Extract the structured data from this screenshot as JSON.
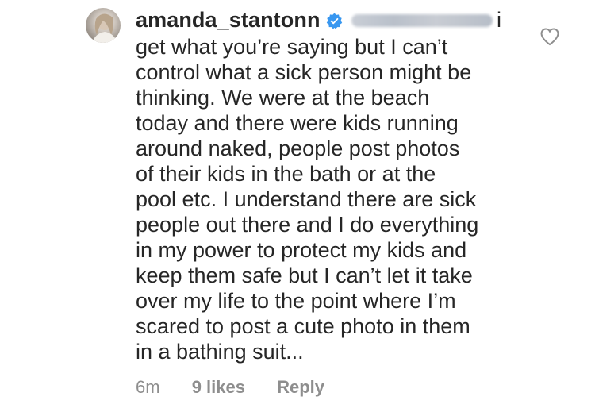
{
  "comment": {
    "username": "amanda_stantonn",
    "verified_icon": "verified-badge-icon",
    "reply_fragment": "i",
    "lines": [
      "get what you’re saying but I can’t",
      "control what a sick person might be",
      "thinking. We were at the beach",
      "today and there were kids running",
      "around naked, people post photos",
      "of their kids in the bath or at the",
      "pool etc. I understand there are sick",
      "people out there and I do everything",
      "in my power to protect my kids and",
      "keep them safe but I can’t let it take",
      "over my life to the point where I’m",
      "scared to post a cute photo in them",
      "in a bathing suit..."
    ],
    "time": "6m",
    "likes": "9 likes",
    "reply_label": "Reply",
    "like_icon": "heart-outline-icon"
  },
  "colors": {
    "text": "#262626",
    "meta": "#8e8e8e",
    "verified": "#3897f0"
  }
}
